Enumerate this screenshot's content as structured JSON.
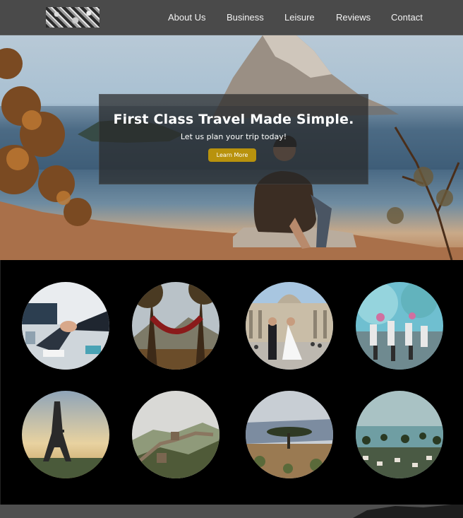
{
  "header": {
    "logo_label": "Site logo",
    "nav": [
      {
        "label": "About Us"
      },
      {
        "label": "Business"
      },
      {
        "label": "Leisure"
      },
      {
        "label": "Reviews"
      },
      {
        "label": "Contact"
      }
    ]
  },
  "hero": {
    "title": "First Class Travel Made Simple.",
    "subtitle": "Let us plan your trip today!",
    "button_label": "Learn More",
    "accent_color": "#b8920d"
  },
  "gallery": {
    "items": [
      {
        "subject": "business-handshake"
      },
      {
        "subject": "hammock-between-trees"
      },
      {
        "subject": "wedding-couple-st-peters-square"
      },
      {
        "subject": "color-festival-crowd"
      },
      {
        "subject": "eiffel-tower"
      },
      {
        "subject": "great-wall"
      },
      {
        "subject": "acacia-tree-savanna"
      },
      {
        "subject": "coastal-town-palms"
      }
    ]
  }
}
